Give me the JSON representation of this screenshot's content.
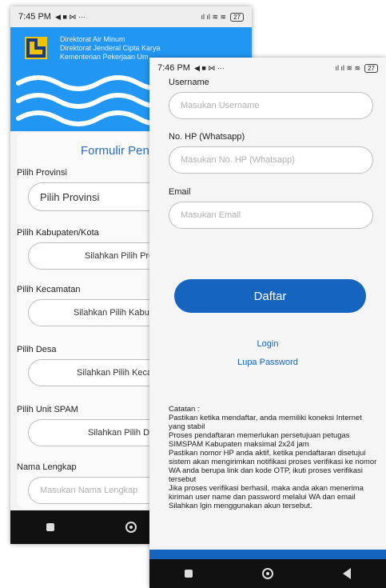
{
  "back_screen": {
    "status": {
      "time": "7:45 PM",
      "icons": "◀ ■ ⋈ ···",
      "right_icons": "ıl ıl ≋ ≋",
      "battery": "27"
    },
    "header": {
      "line1": "Direktorat Air Minum",
      "line2": "Direktorat Jenderal Cipta Karya",
      "line3": "Kementerian Pekerjaan Um",
      "bg_color": "#2196F3"
    },
    "form_title": "Formulir Penda",
    "fields": [
      {
        "label": "Pilih Provinsi",
        "value": "Pilih Provinsi"
      },
      {
        "label": "Pilih Kabupaten/Kota",
        "value": "Silahkan Pilih Pro"
      },
      {
        "label": "Pilih Kecamatan",
        "value": "Silahkan Pilih Kabupa"
      },
      {
        "label": "Pilih Desa",
        "value": "Silahkan Pilih Keca"
      },
      {
        "label": "Pilih Unit SPAM",
        "value": "Silahkan Pilih D"
      },
      {
        "label": "Nama Lengkap",
        "placeholder": "Masukan Nama Lengkap"
      }
    ]
  },
  "front_screen": {
    "status": {
      "time": "7:46 PM",
      "icons": "◀ ■ ⋈ ···",
      "right_icons": "ıl ıl ≋ ≋",
      "battery": "27"
    },
    "fields": [
      {
        "label": "Username",
        "placeholder": "Masukan Username"
      },
      {
        "label": "No. HP (Whatsapp)",
        "placeholder": "Masukan No. HP (Whatsapp)"
      },
      {
        "label": "Email",
        "placeholder": "Masukan Email"
      }
    ],
    "daftar_button": "Daftar",
    "login_link": "Login",
    "lupa_link": "Lupa Password",
    "notes_title": "Catatan :",
    "notes": [
      "Pastikan ketika mendaftar, anda memiliki koneksi Internet yang stabil",
      "Proses pendaftaran memerlukan persetujuan petugas SIMSPAM Kabupaten maksimal 2x24 jam",
      "Pastikan nomor HP anda aktif, ketika pendaftaran disetujui sistem akan mengirimkan notifikasi proses verifikasi ke nomor WA anda berupa link dan kode OTP, ikuti proses verifikasi tersebut",
      "Jika proses verifikasi berhasil, maka anda akan menerima kiriman user name dan password melalui WA dan email",
      "Silahkan lgin menggunakan akun tersebut."
    ],
    "accent_color": "#1565C0"
  },
  "icons": {
    "nav_recent": "recent-apps-icon",
    "nav_home": "home-icon",
    "nav_back": "back-icon"
  }
}
